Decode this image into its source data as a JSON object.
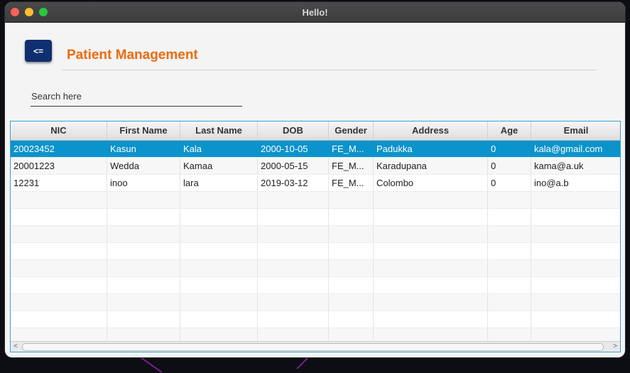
{
  "window": {
    "title": "Hello!",
    "traffic_lights": [
      {
        "name": "close",
        "color": "#fe5f57"
      },
      {
        "name": "minimize",
        "color": "#febc2e"
      },
      {
        "name": "zoom",
        "color": "#28c840"
      }
    ]
  },
  "header": {
    "back_label": "<=",
    "title": "Patient Management",
    "title_color": "#ee6a10",
    "back_button_color": "#0f2f6e"
  },
  "search": {
    "placeholder": "Search here",
    "value": ""
  },
  "table": {
    "columns": [
      "NIC",
      "First Name",
      "Last Name",
      "DOB",
      "Gender",
      "Address",
      "Age",
      "Email"
    ],
    "rows": [
      [
        "20023452",
        "Kasun",
        "Kala",
        "2000-10-05",
        "FE_M...",
        "Padukka",
        "0",
        "kala@gmail.com"
      ],
      [
        "20001223",
        "Wedda",
        "Kamaa",
        "2000-05-15",
        "FE_M...",
        "Karadupana",
        "0",
        "kama@a.uk"
      ],
      [
        "12231",
        "inoo",
        "lara",
        "2019-03-12",
        "FE_M...",
        "Colombo",
        "0",
        "ino@a.b"
      ]
    ],
    "selected_row": 0,
    "selection_color": "#0b93cb",
    "border_color": "#3a9fd6"
  }
}
